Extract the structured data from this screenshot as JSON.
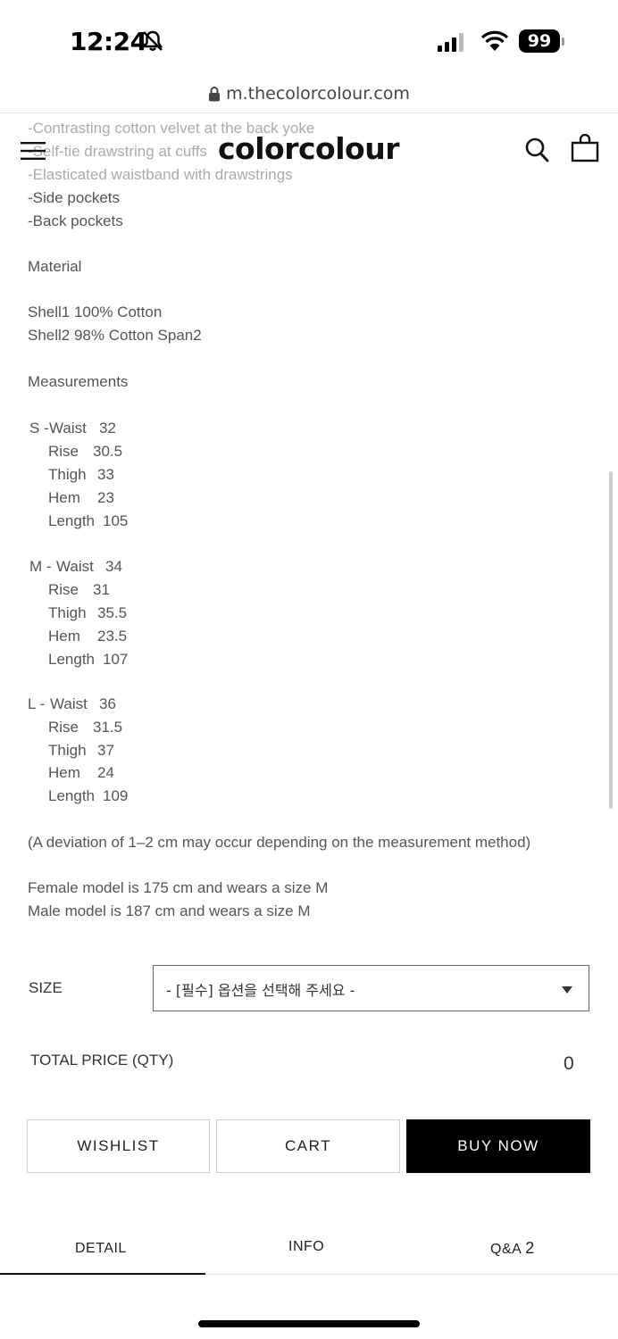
{
  "status_bar": {
    "time": "12:24",
    "battery": "99"
  },
  "browser": {
    "url": "m.thecolorcolour.com"
  },
  "header": {
    "logo": "colorcolour"
  },
  "description": {
    "features": [
      "-Contrasting cotton velvet at the back yoke",
      "-Self-tie drawstring at cuffs",
      "-Elasticated waistband with drawstrings",
      "-Side pockets",
      "-Back pockets"
    ],
    "material_heading": "Material",
    "materials": [
      "Shell1 100% Cotton",
      "Shell2 98% Cotton Span2"
    ],
    "measurements_heading": "Measurements",
    "sizes": [
      {
        "size": "S -",
        "rows": [
          [
            "Waist",
            "32"
          ],
          [
            "Rise",
            "30.5"
          ],
          [
            "Thigh",
            "33"
          ],
          [
            "Hem",
            "23"
          ],
          [
            "Length",
            "105"
          ]
        ]
      },
      {
        "size": "M -",
        "rows": [
          [
            "Waist",
            "34"
          ],
          [
            "Rise",
            "31"
          ],
          [
            "Thigh",
            "35.5"
          ],
          [
            "Hem",
            "23.5"
          ],
          [
            "Length",
            "107"
          ]
        ]
      },
      {
        "size": "L -",
        "rows": [
          [
            "Waist",
            "36"
          ],
          [
            "Rise",
            "31.5"
          ],
          [
            "Thigh",
            "37"
          ],
          [
            "Hem",
            "24"
          ],
          [
            "Length",
            "109"
          ]
        ]
      }
    ],
    "deviation_note": "(A deviation of 1–2 cm may occur depending on the measurement method)",
    "models": [
      "Female model is 175 cm and wears a size M",
      "Male model is 187 cm and wears a size M"
    ]
  },
  "purchase": {
    "size_label": "SIZE",
    "size_select_placeholder": "- [필수] 옵션을 선택해 주세요 -",
    "total_label": "TOTAL PRICE (QTY)",
    "total_value": "0",
    "wishlist_label": "WISHLIST",
    "cart_label": "CART",
    "buy_now_label": "BUY NOW"
  },
  "tabs": {
    "detail": "DETAIL",
    "info": "INFO",
    "qa": "Q&A",
    "qa_count": "2"
  },
  "colors": {
    "accent": "#000000",
    "text": "#555555",
    "faded_text": "#aaaaaa"
  }
}
